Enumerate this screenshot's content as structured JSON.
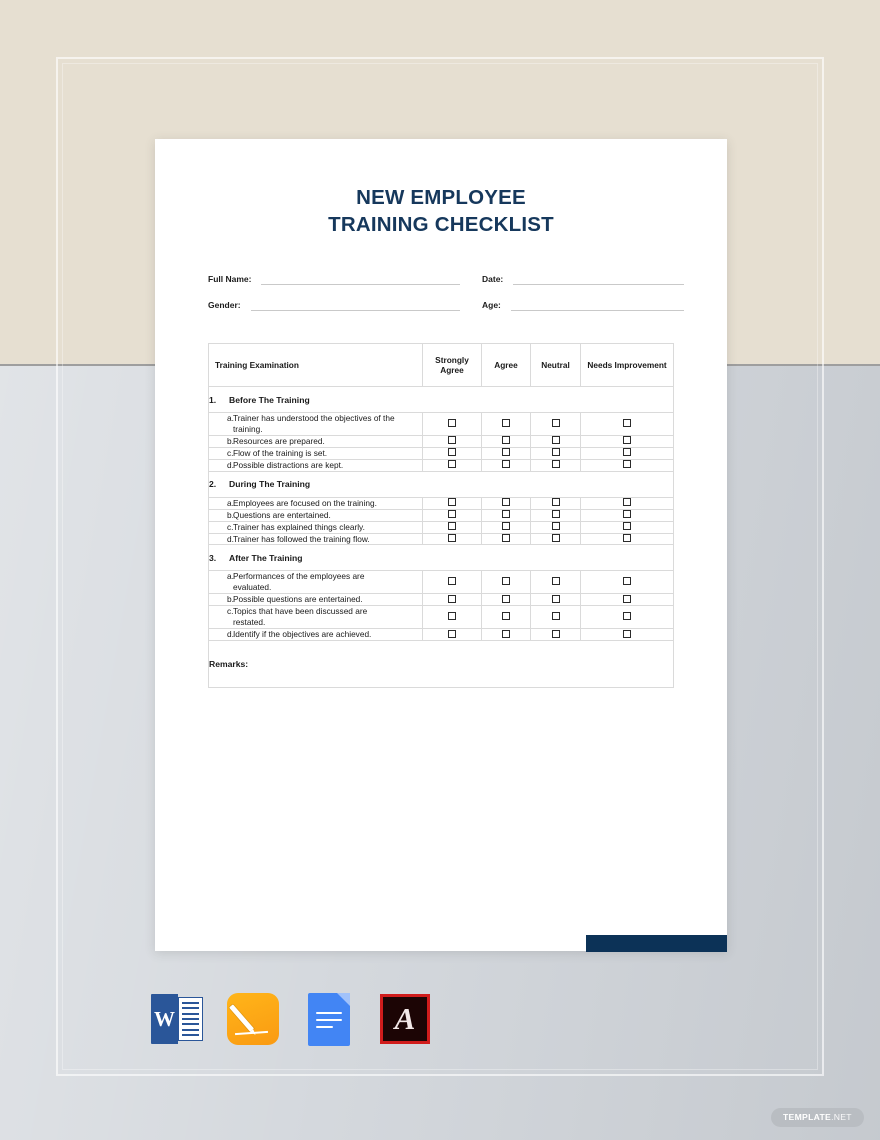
{
  "backdrop": {
    "upper_color": "#e6dfd1",
    "lower_color": "#d4d8dd",
    "divider_color": "#9e9e9e"
  },
  "document": {
    "title_line_1": "NEW EMPLOYEE",
    "title_line_2": "TRAINING CHECKLIST",
    "title_color": "#16385c",
    "accent_bar_color": "#0c3257",
    "page_color": "#ffffff"
  },
  "meta_fields": {
    "full_name_label": "Full Name:",
    "full_name_value": "",
    "date_label": "Date:",
    "date_value": "",
    "gender_label": "Gender:",
    "gender_value": "",
    "age_label": "Age:",
    "age_value": ""
  },
  "table": {
    "headers": {
      "examination": "Training Examination",
      "strongly_agree": "Strongly Agree",
      "agree": "Agree",
      "neutral": "Neutral",
      "needs_improvement": "Needs Improvement"
    },
    "sections": [
      {
        "number": "1.",
        "title": "Before The Training",
        "items": [
          {
            "letter": "a.",
            "text": "Trainer has understood the objectives of the training."
          },
          {
            "letter": "b.",
            "text": "Resources are prepared."
          },
          {
            "letter": "c.",
            "text": "Flow of the training is set."
          },
          {
            "letter": "d.",
            "text": "Possible distractions are kept."
          }
        ]
      },
      {
        "number": "2.",
        "title": "During The Training",
        "items": [
          {
            "letter": "a.",
            "text": "Employees are focused on the training."
          },
          {
            "letter": "b.",
            "text": "Questions are entertained."
          },
          {
            "letter": "c.",
            "text": "Trainer has explained things clearly."
          },
          {
            "letter": "d.",
            "text": "Trainer has followed the training flow."
          }
        ]
      },
      {
        "number": "3.",
        "title": "After The Training",
        "items": [
          {
            "letter": "a.",
            "text": "Performances of the employees are evaluated."
          },
          {
            "letter": "b.",
            "text": "Possible questions are entertained."
          },
          {
            "letter": "c.",
            "text": "Topics that have been discussed are restated."
          },
          {
            "letter": "d.",
            "text": "Identify if the objectives are achieved."
          }
        ]
      }
    ],
    "remarks_label": "Remarks:",
    "remarks_value": ""
  },
  "format_icons": [
    {
      "name": "microsoft-word-icon",
      "label": "W"
    },
    {
      "name": "apple-pages-icon",
      "label": ""
    },
    {
      "name": "google-docs-icon",
      "label": ""
    },
    {
      "name": "adobe-pdf-icon",
      "label": "A"
    }
  ],
  "watermark": {
    "text_bold": "TEMPLATE",
    "text_light": ".NET"
  }
}
